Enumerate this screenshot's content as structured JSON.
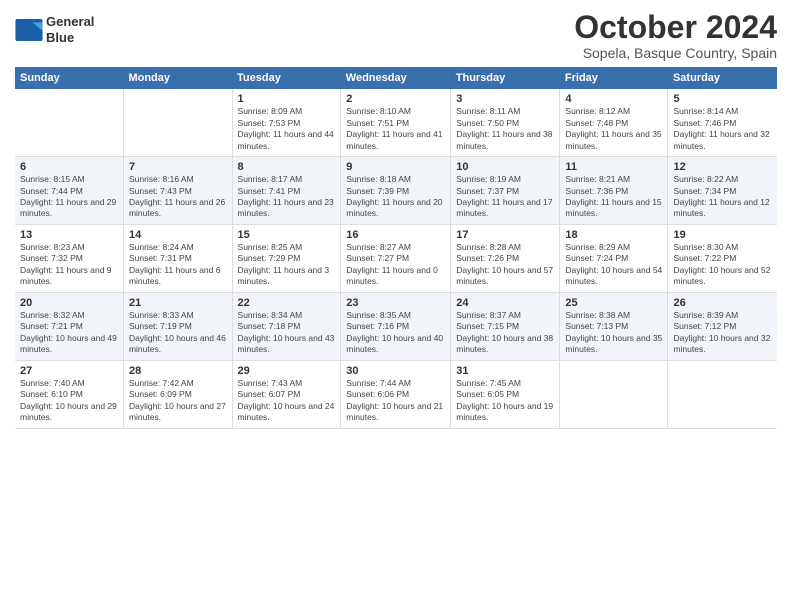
{
  "logo": {
    "line1": "General",
    "line2": "Blue"
  },
  "title": "October 2024",
  "location": "Sopela, Basque Country, Spain",
  "weekdays": [
    "Sunday",
    "Monday",
    "Tuesday",
    "Wednesday",
    "Thursday",
    "Friday",
    "Saturday"
  ],
  "weeks": [
    [
      {
        "day": "",
        "info": ""
      },
      {
        "day": "",
        "info": ""
      },
      {
        "day": "1",
        "info": "Sunrise: 8:09 AM\nSunset: 7:53 PM\nDaylight: 11 hours and 44 minutes."
      },
      {
        "day": "2",
        "info": "Sunrise: 8:10 AM\nSunset: 7:51 PM\nDaylight: 11 hours and 41 minutes."
      },
      {
        "day": "3",
        "info": "Sunrise: 8:11 AM\nSunset: 7:50 PM\nDaylight: 11 hours and 38 minutes."
      },
      {
        "day": "4",
        "info": "Sunrise: 8:12 AM\nSunset: 7:48 PM\nDaylight: 11 hours and 35 minutes."
      },
      {
        "day": "5",
        "info": "Sunrise: 8:14 AM\nSunset: 7:46 PM\nDaylight: 11 hours and 32 minutes."
      }
    ],
    [
      {
        "day": "6",
        "info": "Sunrise: 8:15 AM\nSunset: 7:44 PM\nDaylight: 11 hours and 29 minutes."
      },
      {
        "day": "7",
        "info": "Sunrise: 8:16 AM\nSunset: 7:43 PM\nDaylight: 11 hours and 26 minutes."
      },
      {
        "day": "8",
        "info": "Sunrise: 8:17 AM\nSunset: 7:41 PM\nDaylight: 11 hours and 23 minutes."
      },
      {
        "day": "9",
        "info": "Sunrise: 8:18 AM\nSunset: 7:39 PM\nDaylight: 11 hours and 20 minutes."
      },
      {
        "day": "10",
        "info": "Sunrise: 8:19 AM\nSunset: 7:37 PM\nDaylight: 11 hours and 17 minutes."
      },
      {
        "day": "11",
        "info": "Sunrise: 8:21 AM\nSunset: 7:36 PM\nDaylight: 11 hours and 15 minutes."
      },
      {
        "day": "12",
        "info": "Sunrise: 8:22 AM\nSunset: 7:34 PM\nDaylight: 11 hours and 12 minutes."
      }
    ],
    [
      {
        "day": "13",
        "info": "Sunrise: 8:23 AM\nSunset: 7:32 PM\nDaylight: 11 hours and 9 minutes."
      },
      {
        "day": "14",
        "info": "Sunrise: 8:24 AM\nSunset: 7:31 PM\nDaylight: 11 hours and 6 minutes."
      },
      {
        "day": "15",
        "info": "Sunrise: 8:25 AM\nSunset: 7:29 PM\nDaylight: 11 hours and 3 minutes."
      },
      {
        "day": "16",
        "info": "Sunrise: 8:27 AM\nSunset: 7:27 PM\nDaylight: 11 hours and 0 minutes."
      },
      {
        "day": "17",
        "info": "Sunrise: 8:28 AM\nSunset: 7:26 PM\nDaylight: 10 hours and 57 minutes."
      },
      {
        "day": "18",
        "info": "Sunrise: 8:29 AM\nSunset: 7:24 PM\nDaylight: 10 hours and 54 minutes."
      },
      {
        "day": "19",
        "info": "Sunrise: 8:30 AM\nSunset: 7:22 PM\nDaylight: 10 hours and 52 minutes."
      }
    ],
    [
      {
        "day": "20",
        "info": "Sunrise: 8:32 AM\nSunset: 7:21 PM\nDaylight: 10 hours and 49 minutes."
      },
      {
        "day": "21",
        "info": "Sunrise: 8:33 AM\nSunset: 7:19 PM\nDaylight: 10 hours and 46 minutes."
      },
      {
        "day": "22",
        "info": "Sunrise: 8:34 AM\nSunset: 7:18 PM\nDaylight: 10 hours and 43 minutes."
      },
      {
        "day": "23",
        "info": "Sunrise: 8:35 AM\nSunset: 7:16 PM\nDaylight: 10 hours and 40 minutes."
      },
      {
        "day": "24",
        "info": "Sunrise: 8:37 AM\nSunset: 7:15 PM\nDaylight: 10 hours and 38 minutes."
      },
      {
        "day": "25",
        "info": "Sunrise: 8:38 AM\nSunset: 7:13 PM\nDaylight: 10 hours and 35 minutes."
      },
      {
        "day": "26",
        "info": "Sunrise: 8:39 AM\nSunset: 7:12 PM\nDaylight: 10 hours and 32 minutes."
      }
    ],
    [
      {
        "day": "27",
        "info": "Sunrise: 7:40 AM\nSunset: 6:10 PM\nDaylight: 10 hours and 29 minutes."
      },
      {
        "day": "28",
        "info": "Sunrise: 7:42 AM\nSunset: 6:09 PM\nDaylight: 10 hours and 27 minutes."
      },
      {
        "day": "29",
        "info": "Sunrise: 7:43 AM\nSunset: 6:07 PM\nDaylight: 10 hours and 24 minutes."
      },
      {
        "day": "30",
        "info": "Sunrise: 7:44 AM\nSunset: 6:06 PM\nDaylight: 10 hours and 21 minutes."
      },
      {
        "day": "31",
        "info": "Sunrise: 7:45 AM\nSunset: 6:05 PM\nDaylight: 10 hours and 19 minutes."
      },
      {
        "day": "",
        "info": ""
      },
      {
        "day": "",
        "info": ""
      }
    ]
  ]
}
